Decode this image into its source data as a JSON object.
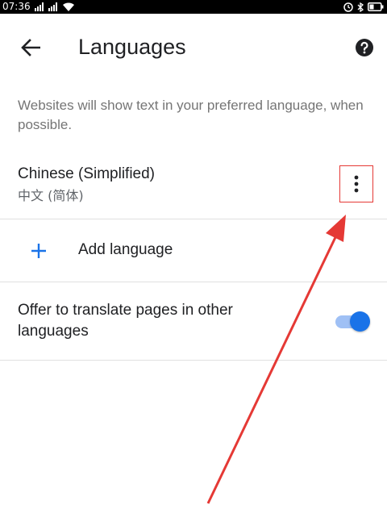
{
  "status_bar": {
    "time": "07:36"
  },
  "app_bar": {
    "title": "Languages"
  },
  "description": "Websites will show text in your preferred language, when possible.",
  "languages": [
    {
      "name": "Chinese (Simplified)",
      "native_name": "中文 (简体)"
    }
  ],
  "add_language": {
    "label": "Add language"
  },
  "translate_setting": {
    "label": "Offer to translate pages in other languages",
    "enabled": true
  },
  "colors": {
    "accent": "#1a73e8",
    "annotation": "#e53935"
  },
  "icons": {
    "back": "arrow-back-icon",
    "help": "help-icon",
    "more": "more-vertical-icon",
    "add": "plus-icon"
  }
}
